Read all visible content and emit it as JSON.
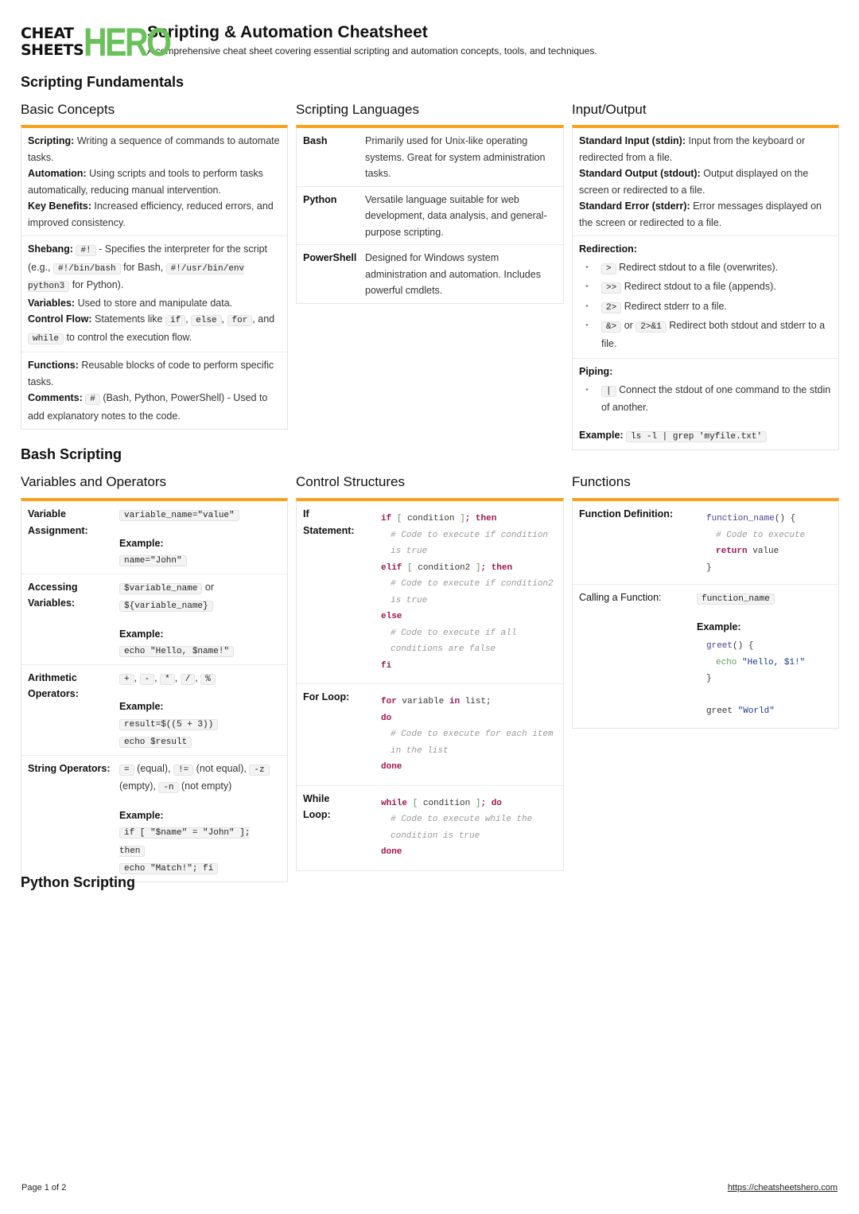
{
  "header": {
    "logo_top": "CHEAT",
    "logo_bottom": "SHEETS",
    "logo_hero": "HERO",
    "title": "Scripting & Automation Cheatsheet",
    "subtitle": "A comprehensive cheat sheet covering essential scripting and automation concepts, tools, and techniques."
  },
  "sections": {
    "fundamentals": "Scripting Fundamentals",
    "bash": "Bash Scripting",
    "python": "Python Scripting"
  },
  "basic_concepts": {
    "title": "Basic Concepts",
    "scripting_label": "Scripting:",
    "scripting_text": "Writing a sequence of commands to automate tasks.",
    "automation_label": "Automation:",
    "automation_text": "Using scripts and tools to perform tasks automatically, reducing manual intervention.",
    "benefits_label": "Key Benefits:",
    "benefits_text": "Increased efficiency, reduced errors, and improved consistency.",
    "shebang_label": "Shebang:",
    "shebang_code": "#!",
    "shebang_text1": "- Specifies the interpreter for the script (e.g.,",
    "shebang_code2": "#!/bin/bash",
    "shebang_text2": "for Bash,",
    "shebang_code3": "#!/usr/bin/env python3",
    "shebang_text3": "for Python).",
    "variables_label": "Variables:",
    "variables_text": "Used to store and manipulate data.",
    "control_label": "Control Flow:",
    "control_text1": "Statements like",
    "control_codes": [
      "if",
      "else",
      "for",
      "while"
    ],
    "control_and": ", and",
    "control_text2": "to control the execution flow.",
    "functions_label": "Functions:",
    "functions_text": "Reusable blocks of code to perform specific tasks.",
    "comments_label": "Comments:",
    "comments_code": "#",
    "comments_text": "(Bash, Python, PowerShell) - Used to add explanatory notes to the code."
  },
  "scripting_languages": {
    "title": "Scripting Languages",
    "rows": [
      {
        "name": "Bash",
        "desc": "Primarily used for Unix-like operating systems. Great for system administration tasks."
      },
      {
        "name": "Python",
        "desc": "Versatile language suitable for web development, data analysis, and general-purpose scripting."
      },
      {
        "name": "PowerShell",
        "desc": "Designed for Windows system administration and automation. Includes powerful cmdlets."
      }
    ]
  },
  "input_output": {
    "title": "Input/Output",
    "stdin_label": "Standard Input (stdin):",
    "stdin_text": "Input from the keyboard or redirected from a file.",
    "stdout_label": "Standard Output (stdout):",
    "stdout_text": "Output displayed on the screen or redirected to a file.",
    "stderr_label": "Standard Error (stderr):",
    "stderr_text": "Error messages displayed on the screen or redirected to a file.",
    "redirection_label": "Redirection:",
    "redirection_items": [
      {
        "code": ">",
        "text": "Redirect stdout to a file (overwrites)."
      },
      {
        "code": ">>",
        "text": "Redirect stdout to a file (appends)."
      },
      {
        "code": "2>",
        "text": "Redirect stderr to a file."
      },
      {
        "code": "&>",
        "or": "or",
        "code2": "2>&1",
        "text": "Redirect both stdout and stderr to a file."
      }
    ],
    "piping_label": "Piping:",
    "piping_items": [
      {
        "code": "|",
        "text": "Connect the stdout of one command to the stdin of another."
      }
    ],
    "example_label": "Example:",
    "example_code": "ls -l | grep 'myfile.txt'"
  },
  "variables_operators": {
    "title": "Variables and Operators",
    "example_label": "Example:",
    "assign_label": "Variable Assignment:",
    "assign_code": "variable_name=\"value\"",
    "assign_example": "name=\"John\"",
    "access_label": "Accessing Variables:",
    "access_code1": "$variable_name",
    "access_or": "or",
    "access_code2": "${variable_name}",
    "access_example": "echo \"Hello, $name!\"",
    "arith_label": "Arithmetic Operators:",
    "arith_codes": [
      "+",
      "-",
      "*",
      "/",
      "%"
    ],
    "arith_example1": "result=$((5 + 3))",
    "arith_example2": "echo $result",
    "string_label": "String Operators:",
    "string_ops": [
      {
        "code": "=",
        "text": "(equal),"
      },
      {
        "code": "!=",
        "text": "(not equal),"
      },
      {
        "code": "-z",
        "text": "(empty),"
      },
      {
        "code": "-n",
        "text": "(not empty)"
      }
    ],
    "string_example1": "if [ \"$name\" = \"John\" ]; then",
    "string_example2": "echo \"Match!\"; fi"
  },
  "control_structures": {
    "title": "Control Structures",
    "if_label": "If Statement:",
    "for_label": "For Loop:",
    "while_label": "While Loop:",
    "if_code": {
      "if": "if",
      "cond": "condition",
      "then": "then",
      "cm1": "# Code to execute if condition is true",
      "elif": "elif",
      "cond2": "condition2",
      "cm2": "# Code to execute if condition2 is true",
      "else": "else",
      "cm3": "# Code to execute if all conditions are false",
      "fi": "fi"
    },
    "for_code": {
      "for": "for",
      "var": "variable",
      "in": "in",
      "list": "list;",
      "do": "do",
      "cm": "# Code to execute for each item in the list",
      "done": "done"
    },
    "while_code": {
      "while": "while",
      "cond": "condition",
      "do": "do",
      "cm": "# Code to execute while the condition is true",
      "done": "done"
    }
  },
  "functions": {
    "title": "Functions",
    "def_label": "Function Definition:",
    "def_code": {
      "name": "function_name",
      "open": "() {",
      "cm": "# Code to execute",
      "ret": "return",
      "val": "value",
      "close": "}"
    },
    "call_label": "Calling a Function:",
    "call_code": "function_name",
    "example_label": "Example:",
    "example_code": {
      "name": "greet",
      "open": "() {",
      "echo": "echo",
      "str": "\"Hello, $1!\"",
      "close": "}",
      "call": "greet",
      "arg": "\"World\""
    }
  },
  "footer": {
    "page": "Page 1 of 2",
    "url": "https://cheatsheetshero.com"
  }
}
